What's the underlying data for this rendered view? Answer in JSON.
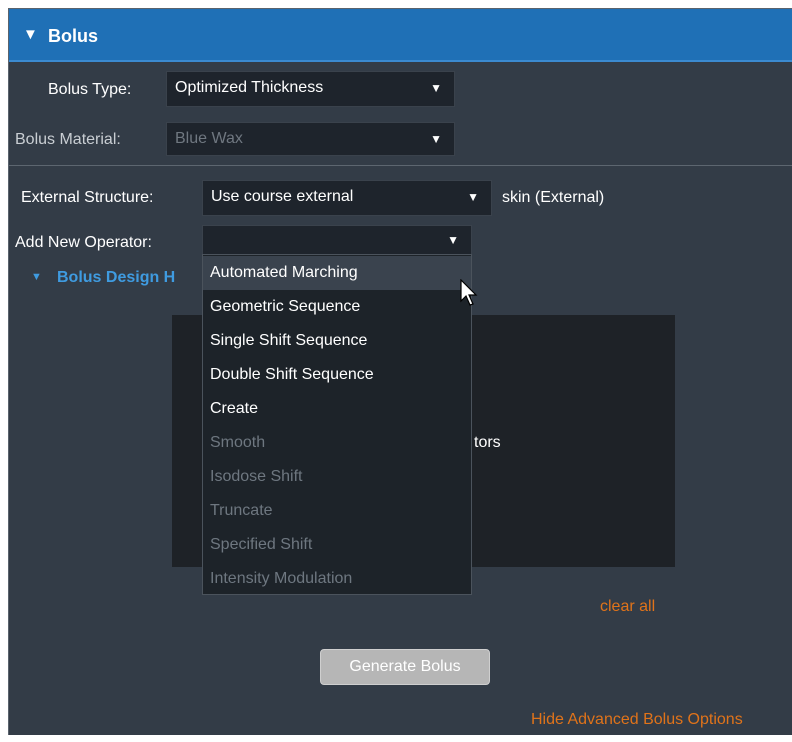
{
  "panel": {
    "title": "Bolus",
    "collapse_glyph": "▼"
  },
  "bolus_type": {
    "label": "Bolus Type:",
    "value": "Optimized Thickness"
  },
  "bolus_material": {
    "label": "Bolus Material:",
    "value": "Blue Wax",
    "disabled": true
  },
  "external_structure": {
    "label": "External Structure:",
    "value": "Use course external",
    "suffix": "skin (External)"
  },
  "add_operator": {
    "label": "Add New Operator:",
    "value": "",
    "options": [
      {
        "label": "Automated Marching",
        "enabled": true,
        "hovered": true
      },
      {
        "label": "Geometric Sequence",
        "enabled": true
      },
      {
        "label": "Single Shift Sequence",
        "enabled": true
      },
      {
        "label": "Double Shift Sequence",
        "enabled": true
      },
      {
        "label": "Create",
        "enabled": true
      },
      {
        "label": "Smooth",
        "enabled": false
      },
      {
        "label": "Isodose Shift",
        "enabled": false
      },
      {
        "label": "Truncate",
        "enabled": false
      },
      {
        "label": "Specified Shift",
        "enabled": false
      },
      {
        "label": "Intensity Modulation",
        "enabled": false
      }
    ]
  },
  "design_section": {
    "label": "Bolus Design H",
    "glyph": "▼"
  },
  "operators_area": {
    "text": "tors"
  },
  "clear_all": "clear all",
  "generate_button": "Generate Bolus",
  "hide_advanced": "Hide Advanced Bolus Options",
  "arrow_glyph": "▼",
  "colors": {
    "header": "#1f70b6",
    "panel_bg": "#333c47",
    "link_orange": "#e0731a",
    "link_blue": "#3f9be0"
  }
}
